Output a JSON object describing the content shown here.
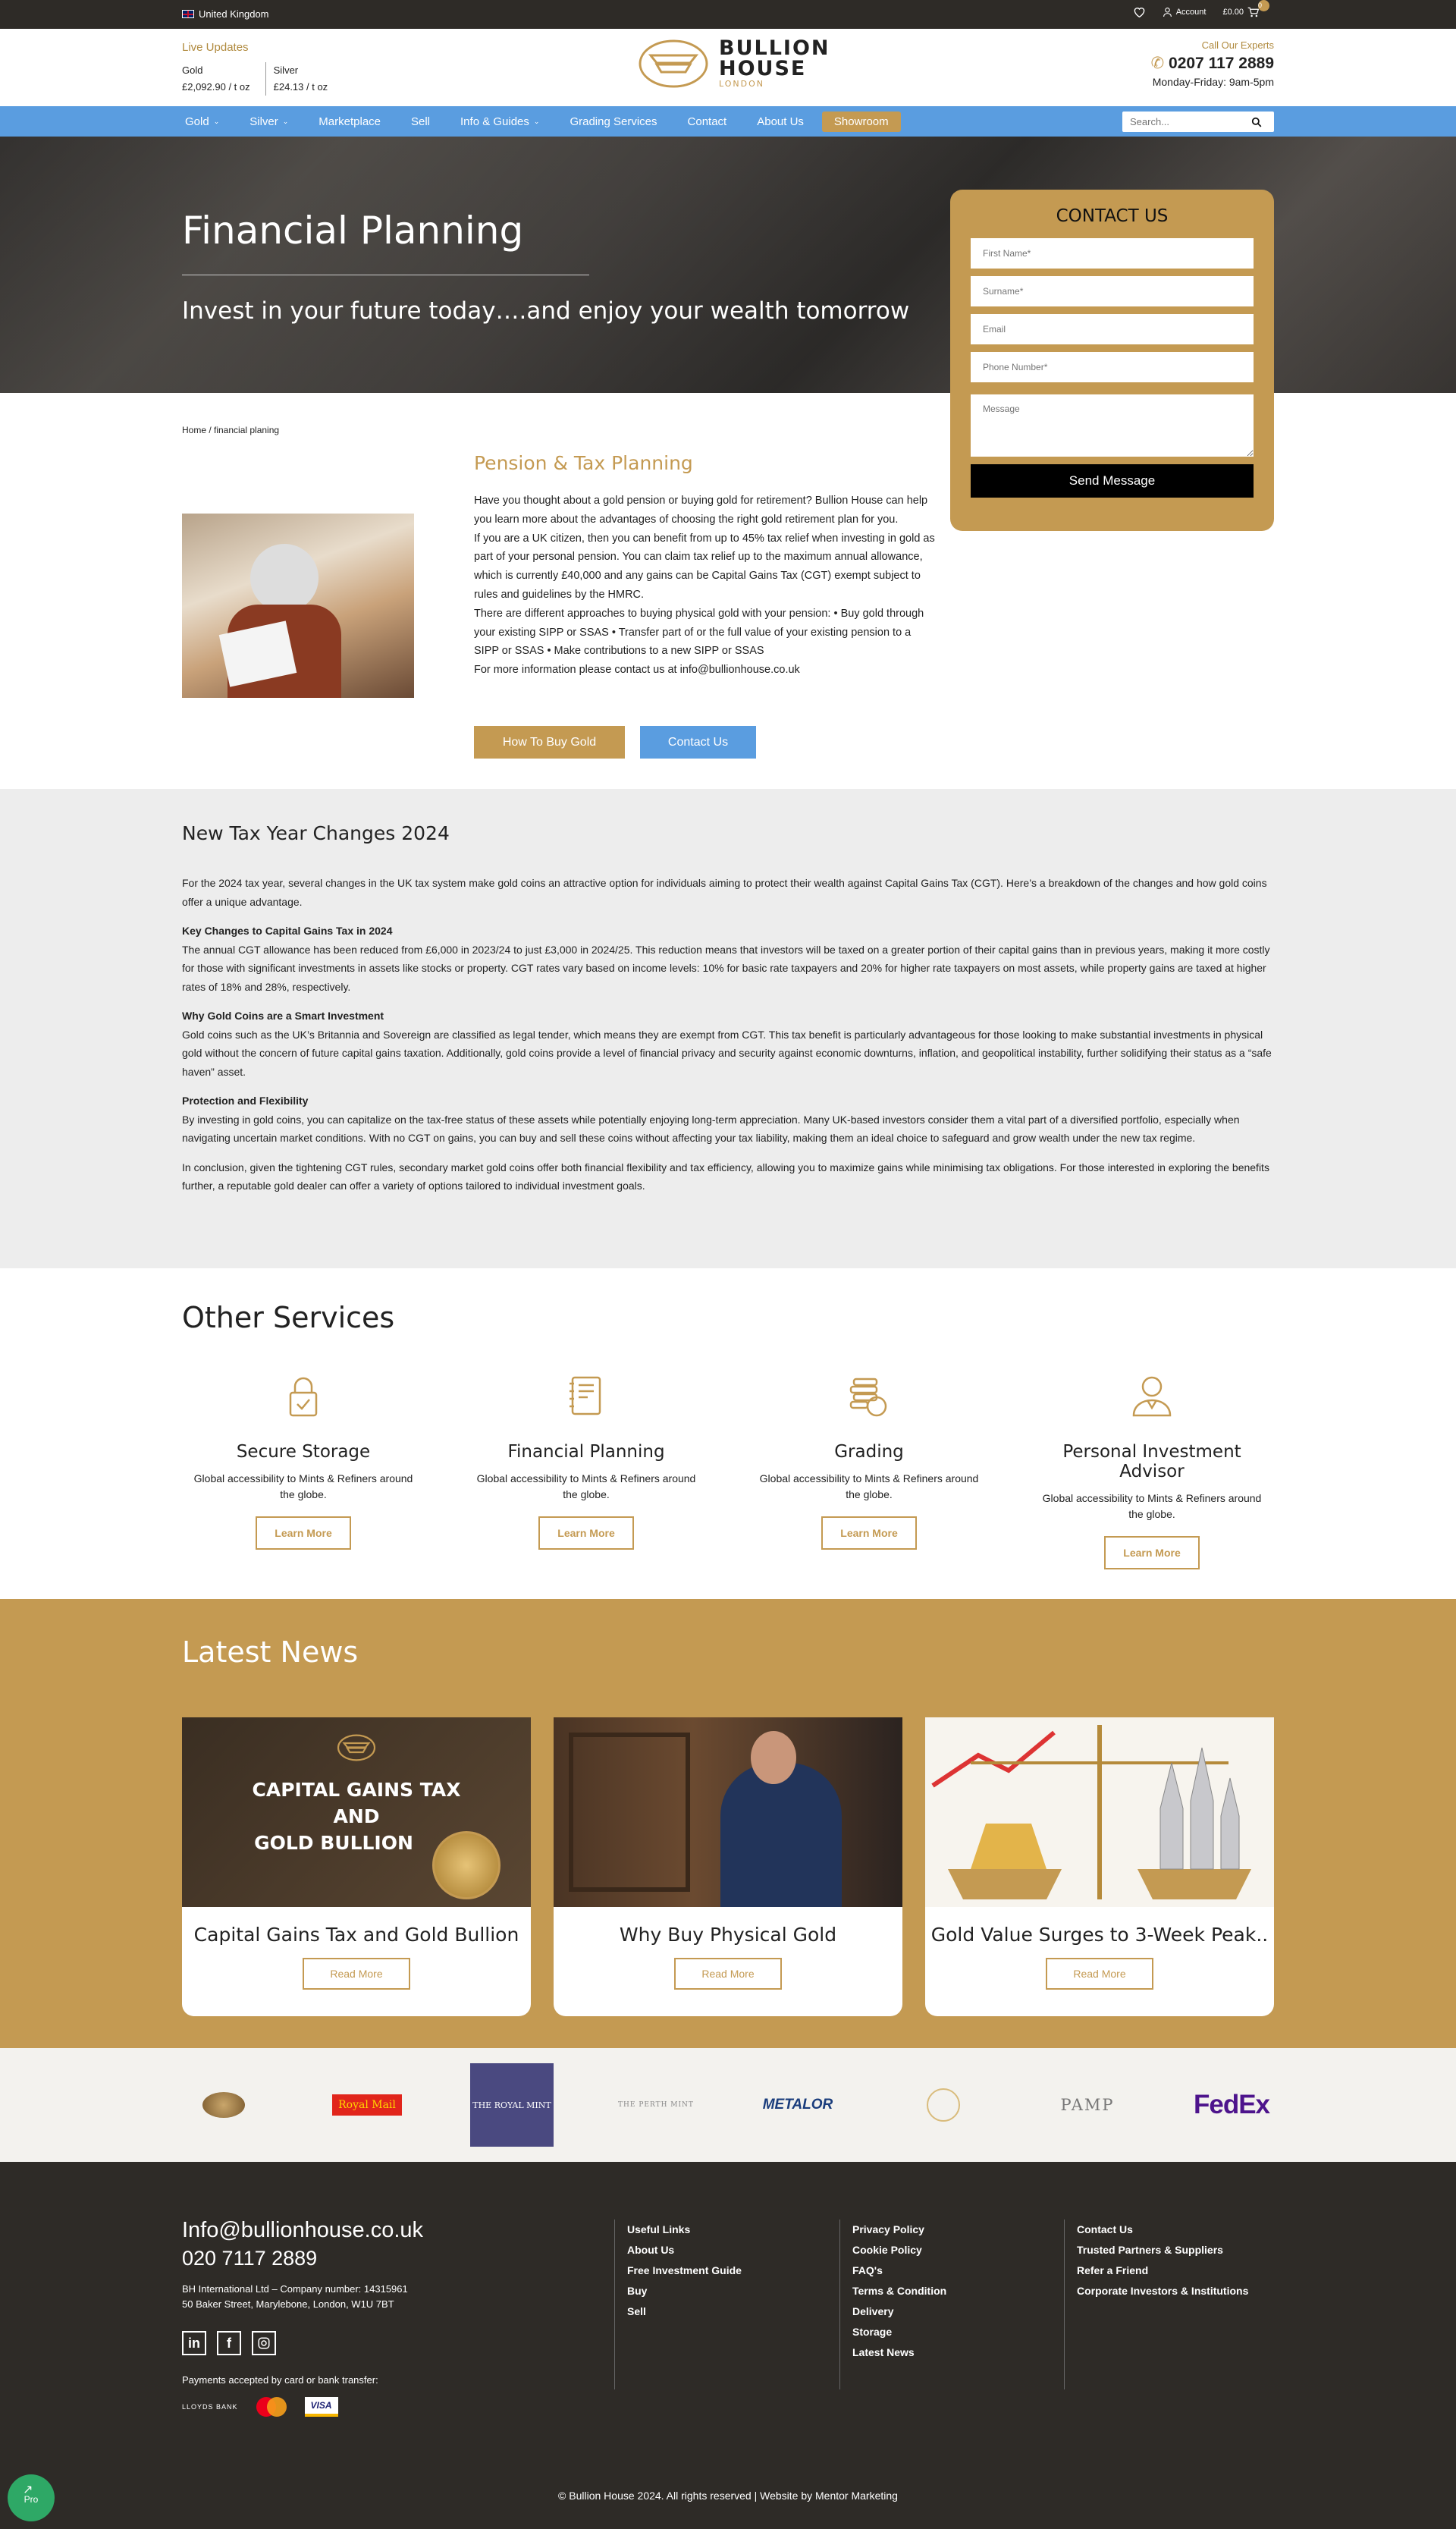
{
  "topbar": {
    "country": "United Kingdom",
    "account": "Account",
    "cart_total": "£0.00",
    "cart_count": "0"
  },
  "header": {
    "live_updates": "Live Updates",
    "gold_label": "Gold",
    "gold_price": "£2,092.90 / t oz",
    "silver_label": "Silver",
    "silver_price": "£24.13 / t oz",
    "logo_line1": "BULLION",
    "logo_line2": "HOUSE",
    "logo_sub": "LONDON",
    "call_label": "Call Our Experts",
    "phone": "0207 117 2889",
    "hours": "Monday-Friday: 9am-5pm"
  },
  "nav": {
    "items": [
      "Gold",
      "Silver",
      "Marketplace",
      "Sell",
      "Info & Guides",
      "Grading Services",
      "Contact",
      "About Us",
      "Showroom"
    ],
    "search_placeholder": "Search..."
  },
  "hero": {
    "title": "Financial Planning",
    "subtitle": "Invest in your future today….and enjoy your wealth tomorrow"
  },
  "contact_form": {
    "title": "CONTACT US",
    "first_name": "First Name*",
    "surname": "Surname*",
    "email": "Email",
    "phone": "Phone Number*",
    "message": "Message",
    "send": "Send Message"
  },
  "breadcrumb": "Home / financial planing",
  "pension": {
    "heading": "Pension & Tax Planning",
    "p1": "Have you thought about a gold pension or buying gold for retirement? Bullion House can help you learn more about the advantages of choosing the right gold retirement plan for you.",
    "p2": "If you are a UK citizen, then you can benefit from up to 45% tax relief when investing in gold as part of your personal pension. You can claim tax relief up to the maximum annual allowance, which is currently £40,000 and any gains can be Capital Gains Tax (CGT) exempt subject to rules and guidelines by the HMRC.",
    "p3": "There are different approaches to buying physical gold with your pension: • Buy gold through your existing SIPP or SSAS • Transfer part of or the full value of your existing pension to a SIPP or SSAS • Make contributions to a new SIPP or SSAS",
    "p4": "For more information please contact us at info@bullionhouse.co.uk",
    "btn_buy": "How To Buy Gold",
    "btn_contact": "Contact Us"
  },
  "tax": {
    "heading": "New Tax Year Changes 2024",
    "intro": "For the 2024 tax year, several changes in the UK tax system make gold coins an attractive option for individuals aiming to protect their wealth against Capital Gains Tax (CGT). Here’s a breakdown of the changes and how gold coins offer a unique advantage.",
    "h1": "Key Changes to Capital Gains Tax in 2024",
    "t1": "The annual CGT allowance has been reduced from £6,000 in 2023/24 to just £3,000 in 2024/25. This reduction means that investors will be taxed on a greater portion of their capital gains than in previous years, making it more costly for those with significant investments in assets like stocks or property. CGT rates vary based on income levels: 10% for basic rate taxpayers and 20% for higher rate taxpayers on most assets, while property gains are taxed at higher rates of 18% and 28%, respectively.",
    "h2": "Why Gold Coins are a Smart Investment",
    "t2": "Gold coins such as the UK’s Britannia and Sovereign are classified as legal tender, which means they are exempt from CGT. This tax benefit is particularly advantageous for those looking to make substantial investments in physical gold without the concern of future capital gains taxation. Additionally, gold coins provide a level of financial privacy and security against economic downturns, inflation, and geopolitical instability, further solidifying their status as a “safe haven” asset.",
    "h3": "Protection and Flexibility",
    "t3": "By investing in gold coins, you can capitalize on the tax-free status of these assets while potentially enjoying long-term appreciation. Many UK-based investors consider them a vital part of a diversified portfolio, especially when navigating uncertain market conditions. With no CGT on gains, you can buy and sell these coins without affecting your tax liability, making them an ideal choice to safeguard and grow wealth under the new tax regime.",
    "outro": "In conclusion, given the tightening CGT rules, secondary market gold coins offer both financial flexibility and tax efficiency, allowing you to maximize gains while minimising tax obligations. For those interested in exploring the benefits further, a reputable gold dealer can offer a variety of options tailored to individual investment goals."
  },
  "services": {
    "heading": "Other Services",
    "items": [
      {
        "title": "Secure Storage",
        "desc": "Global accessibility to Mints & Refiners around the globe.",
        "btn": "Learn More",
        "icon": "lock-icon"
      },
      {
        "title": "Financial Planning",
        "desc": "Global accessibility to Mints & Refiners around the globe.",
        "btn": "Learn More",
        "icon": "notebook-icon"
      },
      {
        "title": "Grading",
        "desc": "Global accessibility to Mints & Refiners around the globe.",
        "btn": "Learn More",
        "icon": "coins-icon"
      },
      {
        "title": "Personal Investment Advisor",
        "desc": "Global accessibility to Mints & Refiners around the globe.",
        "btn": "Learn More",
        "icon": "person-icon"
      }
    ]
  },
  "news": {
    "heading": "Latest News",
    "card1_img_text1": "CAPITAL GAINS TAX",
    "card1_img_text2": "AND",
    "card1_img_text3": "GOLD BULLION",
    "items": [
      {
        "title": "Capital Gains Tax and Gold Bullion",
        "btn": "Read More"
      },
      {
        "title": "Why Buy Physical Gold",
        "btn": "Read More"
      },
      {
        "title": "Gold Value Surges to 3-Week Peak..",
        "btn": "Read More"
      }
    ]
  },
  "partners": [
    "Royal Mail",
    "THE ROYAL MINT",
    "THE PERTH MINT",
    "METALOR",
    "PAMP",
    "FedEx"
  ],
  "footer": {
    "email": "Info@bullionhouse.co.uk",
    "phone": "020 7117 2889",
    "company": "BH International Ltd – Company number: 14315961",
    "address": "50 Baker Street, Marylebone, London, W1U 7BT",
    "payments": "Payments accepted by card or bank transfer:",
    "lloyds": "LLOYDS BANK",
    "visa": "VISA",
    "col1": [
      "Useful Links",
      "About Us",
      "Free Investment Guide",
      "Buy",
      "Sell"
    ],
    "col2": [
      "Privacy Policy",
      "Cookie Policy",
      "FAQ's",
      "Terms & Condition",
      "Delivery",
      "Storage",
      "Latest News"
    ],
    "col3": [
      "Contact Us",
      "Trusted Partners & Suppliers",
      "Refer a Friend",
      "Corporate Investors & Institutions"
    ],
    "copyright": "© Bullion House 2024. All rights reserved | Website by Mentor Marketing",
    "pro": "Pro"
  },
  "colors": {
    "gold": "#c49a52",
    "blue": "#5a9de0",
    "dark": "#2e2b27",
    "grey": "#ededed"
  }
}
